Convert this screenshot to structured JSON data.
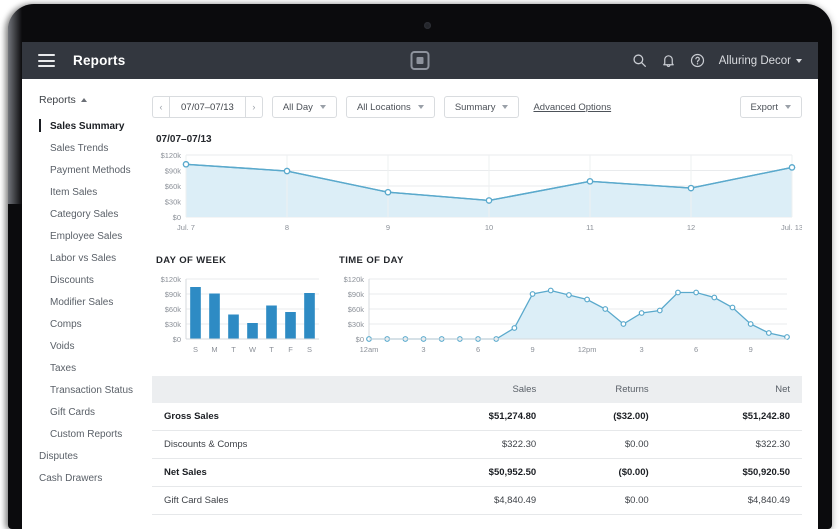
{
  "header": {
    "title": "Reports",
    "menu_icon": "hamburger-icon",
    "logo_icon": "square-logo-icon",
    "search_icon": "search-icon",
    "bell_icon": "bell-icon",
    "help_icon": "help-icon",
    "account": "Alluring Decor"
  },
  "sidebar": {
    "section_label": "Reports",
    "items": [
      {
        "label": "Sales Summary",
        "active": true,
        "level": 2
      },
      {
        "label": "Sales Trends",
        "active": false,
        "level": 2
      },
      {
        "label": "Payment Methods",
        "active": false,
        "level": 2
      },
      {
        "label": "Item Sales",
        "active": false,
        "level": 2
      },
      {
        "label": "Category Sales",
        "active": false,
        "level": 2
      },
      {
        "label": "Employee Sales",
        "active": false,
        "level": 2
      },
      {
        "label": "Labor vs Sales",
        "active": false,
        "level": 2
      },
      {
        "label": "Discounts",
        "active": false,
        "level": 2
      },
      {
        "label": "Modifier Sales",
        "active": false,
        "level": 2
      },
      {
        "label": "Comps",
        "active": false,
        "level": 2
      },
      {
        "label": "Voids",
        "active": false,
        "level": 2
      },
      {
        "label": "Taxes",
        "active": false,
        "level": 2
      },
      {
        "label": "Transaction Status",
        "active": false,
        "level": 2
      },
      {
        "label": "Gift Cards",
        "active": false,
        "level": 2
      },
      {
        "label": "Custom Reports",
        "active": false,
        "level": 2
      },
      {
        "label": "Disputes",
        "active": false,
        "level": 1
      },
      {
        "label": "Cash Drawers",
        "active": false,
        "level": 1
      }
    ]
  },
  "toolbar": {
    "prev_label": "‹",
    "date_range": "07/07–07/13",
    "next_label": "›",
    "time_filter": "All Day",
    "location_filter": "All Locations",
    "view_filter": "Summary",
    "advanced_options": "Advanced Options",
    "export_label": "Export"
  },
  "main_chart_title": "07/07–07/13",
  "panel_titles": {
    "day_of_week": "DAY OF WEEK",
    "time_of_day": "TIME OF DAY"
  },
  "colors": {
    "line": "#5aa9cc",
    "line_fill": "#dceef7",
    "bar": "#2e8bc4",
    "header_bg": "#33373f",
    "table_header_bg": "#eceef0"
  },
  "chart_data": [
    {
      "type": "area",
      "name": "weekly-sales-trend",
      "title": "07/07–07/13",
      "xlabel": "",
      "ylabel": "",
      "ylim": [
        0,
        120000
      ],
      "yticks": [
        0,
        30000,
        60000,
        90000,
        120000
      ],
      "ytick_labels": [
        "$0",
        "$30k",
        "$60k",
        "$90k",
        "$120k"
      ],
      "categories": [
        "Jul. 7",
        "8",
        "9",
        "10",
        "11",
        "12",
        "Jul. 13"
      ],
      "values": [
        102000,
        89000,
        48000,
        32000,
        69000,
        56000,
        96000
      ],
      "grid": true,
      "legend": "none"
    },
    {
      "type": "bar",
      "name": "day-of-week",
      "title": "DAY OF WEEK",
      "xlabel": "",
      "ylabel": "",
      "ylim": [
        0,
        120000
      ],
      "yticks": [
        0,
        30000,
        60000,
        90000,
        120000
      ],
      "ytick_labels": [
        "$0",
        "$30k",
        "$60k",
        "$90k",
        "$120k"
      ],
      "categories": [
        "S",
        "M",
        "T",
        "W",
        "T",
        "F",
        "S"
      ],
      "values": [
        104000,
        91000,
        49000,
        32000,
        67000,
        54000,
        92000
      ],
      "grid": true,
      "legend": "none"
    },
    {
      "type": "area",
      "name": "time-of-day",
      "title": "TIME OF DAY",
      "xlabel": "",
      "ylabel": "",
      "ylim": [
        0,
        120000
      ],
      "yticks": [
        0,
        30000,
        60000,
        90000,
        120000
      ],
      "ytick_labels": [
        "$0",
        "$30k",
        "$60k",
        "$90k",
        "$120k"
      ],
      "categories": [
        "12am",
        "1",
        "2",
        "3",
        "4",
        "5",
        "6",
        "7",
        "8",
        "9",
        "10",
        "11",
        "12pm",
        "1",
        "2",
        "3",
        "4",
        "5",
        "6",
        "7",
        "8",
        "9",
        "10",
        "11"
      ],
      "xtick_labels": [
        "12am",
        "3",
        "6",
        "9",
        "12pm",
        "3",
        "6",
        "9"
      ],
      "values": [
        0,
        0,
        0,
        0,
        0,
        0,
        0,
        0,
        22000,
        90000,
        97000,
        88000,
        79000,
        60000,
        30000,
        52000,
        57000,
        93000,
        93000,
        83000,
        63000,
        30000,
        12000,
        4000
      ],
      "grid": true,
      "legend": "none"
    }
  ],
  "table": {
    "columns": [
      "",
      "Sales",
      "Returns",
      "Net"
    ],
    "rows": [
      {
        "label": "Gross Sales",
        "sales": "$51,274.80",
        "returns": "($32.00)",
        "net": "$51,242.80",
        "bold": true
      },
      {
        "label": "Discounts & Comps",
        "sales": "$322.30",
        "returns": "$0.00",
        "net": "$322.30",
        "bold": false
      },
      {
        "label": "Net Sales",
        "sales": "$50,952.50",
        "returns": "($0.00)",
        "net": "$50,920.50",
        "bold": true
      },
      {
        "label": "Gift Card Sales",
        "sales": "$4,840.49",
        "returns": "$0.00",
        "net": "$4,840.49",
        "bold": false
      }
    ]
  }
}
